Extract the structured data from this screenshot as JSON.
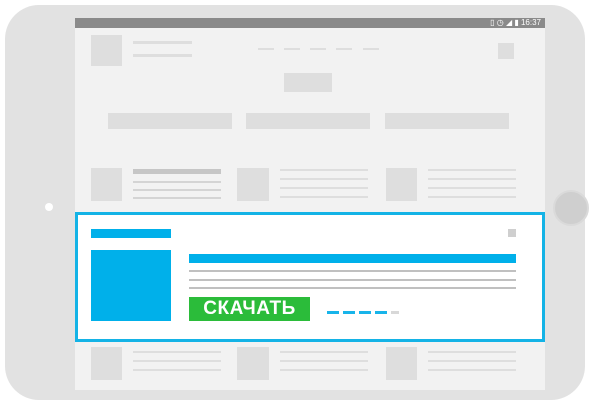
{
  "status_bar": {
    "icons": [
      "data-icon",
      "alarm-icon",
      "signal-icon",
      "battery-icon"
    ],
    "time": "16:37"
  },
  "ad_banner": {
    "download_label": "СКАЧАТЬ"
  },
  "colors": {
    "accent_blue": "#00b0ea",
    "download_green": "#2bbc3a",
    "device": "#e2e2e2",
    "screen": "#f2f2f2",
    "placeholder": "#dedede"
  }
}
